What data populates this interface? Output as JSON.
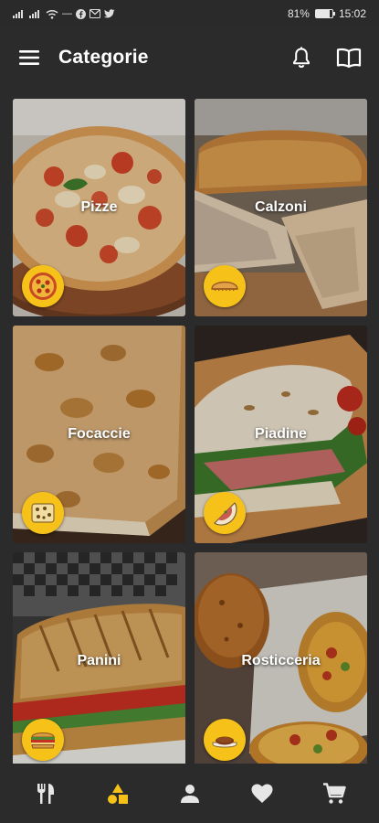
{
  "status_bar": {
    "battery_percent": "81%",
    "battery_level": 0.81,
    "time": "15:02",
    "icons": [
      "signal-icon",
      "signal-icon",
      "wifi-icon",
      "dash-icon",
      "facebook-icon",
      "gmail-icon",
      "twitter-icon"
    ]
  },
  "app_bar": {
    "title": "Categorie",
    "icons": [
      "menu-icon",
      "bell-icon",
      "book-icon"
    ]
  },
  "categories": [
    {
      "label": "Pizze",
      "badge_icon": "pizza-icon"
    },
    {
      "label": "Calzoni",
      "badge_icon": "calzone-icon"
    },
    {
      "label": "Focaccie",
      "badge_icon": "focaccia-icon"
    },
    {
      "label": "Piadine",
      "badge_icon": "piadina-icon"
    },
    {
      "label": "Panini",
      "badge_icon": "sandwich-icon"
    },
    {
      "label": "Rosticceria",
      "badge_icon": "rosticceria-icon"
    }
  ],
  "bottom_nav": {
    "items": [
      {
        "icon": "fork-knife-icon",
        "active": false
      },
      {
        "icon": "shapes-icon",
        "active": true
      },
      {
        "icon": "person-icon",
        "active": false
      },
      {
        "icon": "heart-icon",
        "active": false
      },
      {
        "icon": "cart-icon",
        "active": false
      }
    ]
  },
  "colors": {
    "background": "#2b2b2b",
    "accent": "#f6c21a",
    "text": "#ffffff",
    "icon_inactive": "#e6e6e6"
  }
}
